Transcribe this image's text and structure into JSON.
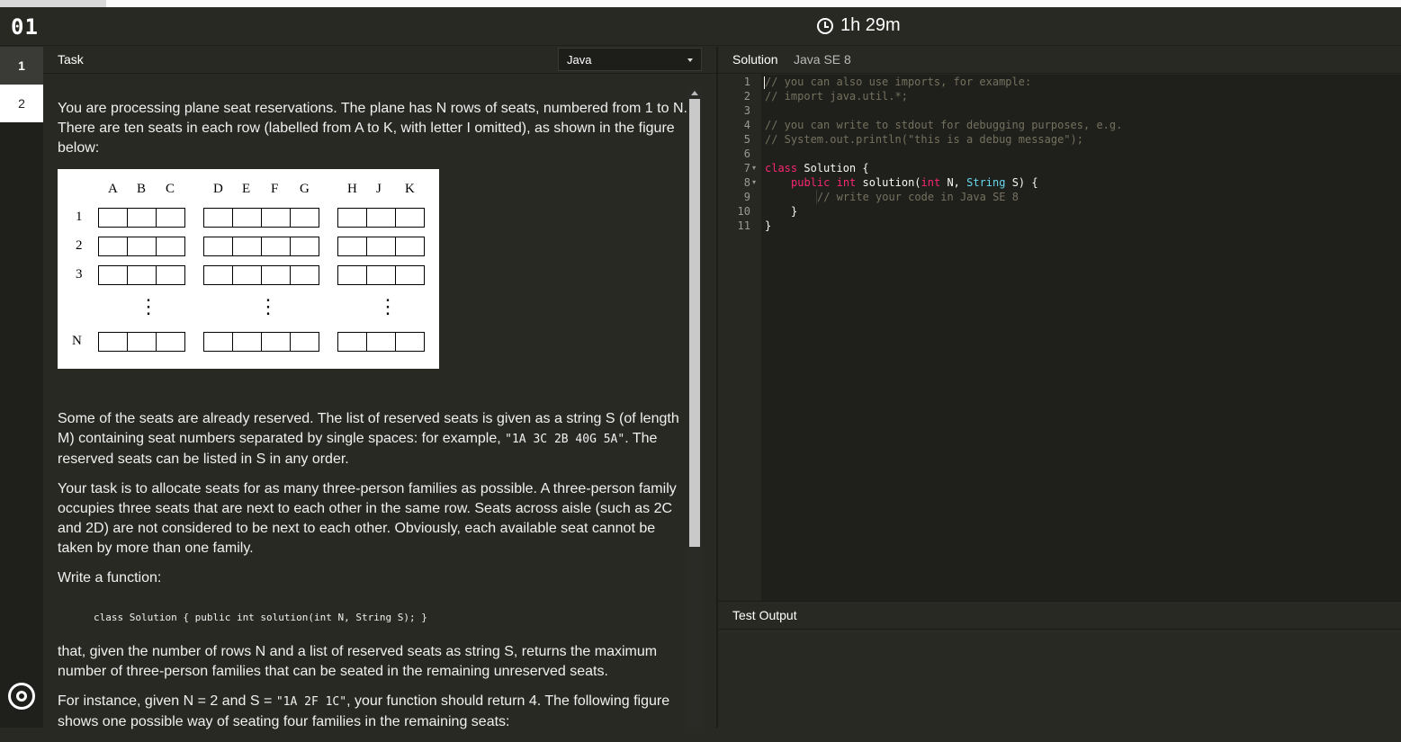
{
  "header": {
    "logo": "01",
    "timer": "1h 29m"
  },
  "rail": {
    "items": [
      "1",
      "2"
    ]
  },
  "task": {
    "label": "Task",
    "language": "Java",
    "para1": "You are processing plane seat reservations. The plane has N rows of seats, numbered from 1 to N. There are ten seats in each row (labelled from A to K, with letter I omitted), as shown in the figure below:",
    "para2_a": "Some of the seats are already reserved. The list of reserved seats is given as a string S (of length M) containing seat numbers separated by single spaces: for example, ",
    "para2_code": "\"1A 3C 2B 40G 5A\"",
    "para2_b": ". The reserved seats can be listed in S in any order.",
    "para3": "Your task is to allocate seats for as many three-person families as possible. A three-person family occupies three seats that are next to each other in the same row. Seats across aisle (such as 2C and 2D) are not considered to be next to each other. Obviously, each available seat cannot be taken by more than one family.",
    "para4": "Write a function:",
    "signature": "class Solution { public int solution(int N, String S); }",
    "para5": "that, given the number of rows N and a list of reserved seats as string S, returns the maximum number of three-person families that can be seated in the remaining unreserved seats.",
    "para6_a": "For instance, given N = 2 and S = ",
    "para6_code": "\"1A 2F 1C\"",
    "para6_b": ", your function should return 4. The following figure shows one possible way of seating four families in the remaining seats:"
  },
  "figure": {
    "columns": [
      "A",
      "B",
      "C",
      "D",
      "E",
      "F",
      "G",
      "H",
      "J",
      "K"
    ],
    "rows": [
      "1",
      "2",
      "3",
      "N"
    ],
    "dots": "⋮"
  },
  "solution": {
    "label": "Solution",
    "lang": "Java SE 8",
    "lines": [
      "// you can also use imports, for example:",
      "// import java.util.*;",
      "",
      "// you can write to stdout for debugging purposes, e.g.",
      "// System.out.println(\"this is a debug message\");",
      "",
      "class Solution {",
      "    public int solution(int N, String S) {",
      "        // write your code in Java SE 8",
      "    }",
      "}"
    ],
    "line_numbers": [
      "1",
      "2",
      "3",
      "4",
      "5",
      "6",
      "7",
      "8",
      "9",
      "10",
      "11"
    ],
    "fold_marker": "▾",
    "code": {
      "l7_kw": "class",
      "l7_name": " Solution {",
      "l8_pub": "public",
      "l8_int": "int",
      "l8_fn": " solution(",
      "l8_int2": "int",
      "l8_n": " N, ",
      "l8_str": "String",
      "l8_s": " S) {",
      "l9": "// write your code in Java SE 8",
      "l10": "}",
      "l11": "}"
    }
  },
  "output": {
    "label": "Test Output"
  },
  "colors": {
    "background": "#282923",
    "editor_bg": "#1f201c",
    "keyword": "#f92672",
    "type": "#66d9ef",
    "comment": "#75715e"
  }
}
